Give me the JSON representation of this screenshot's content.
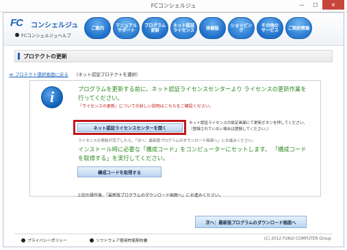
{
  "window": {
    "title": "FCコンシェルジュ",
    "minimize": "—",
    "maximize": "☐",
    "close": "✕"
  },
  "header": {
    "logo_mark": "FC",
    "logo_text": "コンシェルジュ",
    "logo_sub": "FCコンシェルジュヘルプ",
    "nav": [
      "ご案内",
      "マニュアル\nサポート",
      "プログラム\n更新",
      "ネット認証\nライセンス",
      "体験版",
      "ショッピング",
      "その他の\nサービス",
      "ご契約情報"
    ]
  },
  "page": {
    "title": "プロテクトの更新",
    "back_link": "≪ プロテクト選択画面に戻る",
    "back_note": "（ネット認証プロテクトを選択）"
  },
  "content": {
    "headline1": "プログラムを更新する前に、ネット認証ライセンスセンターより ライセンスの更新作業を行ってください。",
    "notice_link": "「ライセンスの更新」についての詳しい説明はこちらをご確認ください。",
    "open_button": "ネット認証ライセンスセンターを開く",
    "side_note_1": "ネット認証ライセンスの設定画面にて更新ボタンを押してください。",
    "side_note_2": "（登録されていない場合は登録してください。）",
    "cropped_line": "ライセンスの更新が完了したら、「次へ：最新版プログラムのダウンロード画面へ」にお進みください。",
    "headline2": "インストール時に必要な「構成コード」をコンピューターにセットします。 「構成コードを取得する」を実行してください。",
    "code_button": "構成コードを取得する",
    "after_note": "上記の操作後、「最新版プログラムのダウンロード画面へ」にお進みください。",
    "next_button": "次へ：最新版プログラムのダウンロード画面へ"
  },
  "footer": {
    "privacy": "プライバシーポリシー",
    "license": "ソフトウェア使用許諾契約書",
    "copyright": "(C) 2012 FUKUI COMPUTER Group"
  }
}
